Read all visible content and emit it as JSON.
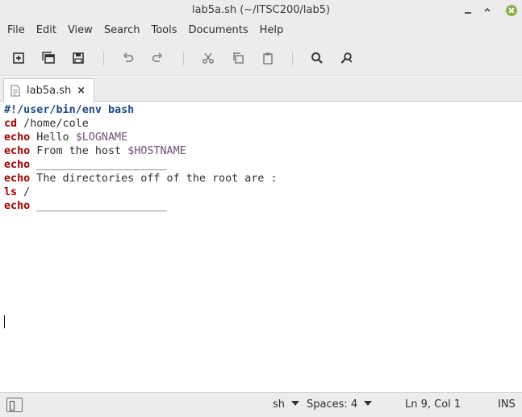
{
  "window": {
    "title": "lab5a.sh (~/ITSC200/lab5)",
    "accent_close": "#8ab04a"
  },
  "menubar": {
    "items": [
      "File",
      "Edit",
      "View",
      "Search",
      "Tools",
      "Documents",
      "Help"
    ]
  },
  "toolbar": {
    "icons": [
      "new-document-icon",
      "new-window-icon",
      "save-icon",
      "undo-icon",
      "redo-icon",
      "cut-icon",
      "copy-icon",
      "paste-icon",
      "search-icon",
      "replace-icon"
    ]
  },
  "tabs": [
    {
      "label": "lab5a.sh",
      "close": "×"
    }
  ],
  "editor": {
    "lines": [
      {
        "parts": [
          {
            "t": "#!/user/bin/env bash",
            "c": "shebang"
          }
        ]
      },
      {
        "parts": [
          {
            "t": "cd",
            "c": "kw"
          },
          {
            "t": " /home/cole",
            "c": ""
          }
        ]
      },
      {
        "parts": [
          {
            "t": "echo",
            "c": "kw"
          },
          {
            "t": " Hello ",
            "c": ""
          },
          {
            "t": "$LOGNAME",
            "c": "var"
          }
        ]
      },
      {
        "parts": [
          {
            "t": "echo",
            "c": "kw"
          },
          {
            "t": " From the host ",
            "c": ""
          },
          {
            "t": "$HOSTNAME",
            "c": "var"
          }
        ]
      },
      {
        "parts": [
          {
            "t": "echo",
            "c": "kw"
          },
          {
            "t": " ____________________",
            "c": ""
          }
        ]
      },
      {
        "parts": [
          {
            "t": "echo",
            "c": "kw"
          },
          {
            "t": " The directories off of the root are :",
            "c": ""
          }
        ]
      },
      {
        "parts": [
          {
            "t": "ls",
            "c": "kw"
          },
          {
            "t": " /",
            "c": ""
          }
        ]
      },
      {
        "parts": [
          {
            "t": "echo",
            "c": "kw"
          },
          {
            "t": " ____________________",
            "c": ""
          }
        ]
      },
      {
        "parts": []
      }
    ]
  },
  "statusbar": {
    "language": "sh",
    "indent": "Spaces: 4",
    "position": "Ln 9, Col 1",
    "mode": "INS"
  }
}
